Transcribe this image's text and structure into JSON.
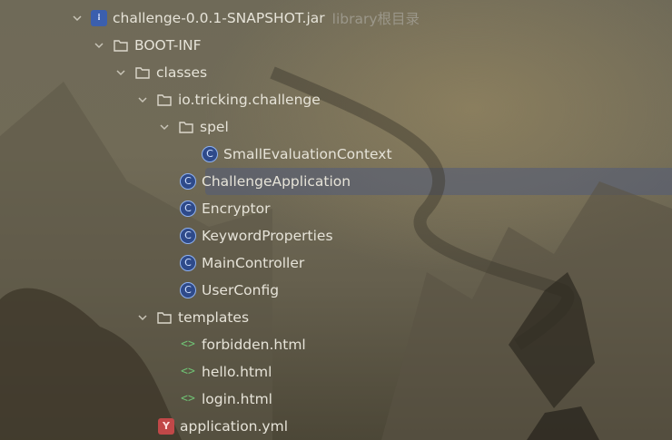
{
  "tree": {
    "jar": {
      "label": "challenge-0.0.1-SNAPSHOT.jar",
      "hint": "library根目录",
      "icon": "jar-icon"
    },
    "boot_inf": {
      "label": "BOOT-INF",
      "icon": "folder-icon"
    },
    "classes": {
      "label": "classes",
      "icon": "folder-icon"
    },
    "package": {
      "label": "io.tricking.challenge",
      "icon": "folder-icon"
    },
    "spel": {
      "label": "spel",
      "icon": "folder-icon"
    },
    "small_eval": {
      "label": "SmallEvaluationContext",
      "icon": "class-icon"
    },
    "challenge_app": {
      "label": "ChallengeApplication",
      "icon": "class-icon",
      "selected": true
    },
    "encryptor": {
      "label": "Encryptor",
      "icon": "class-icon"
    },
    "keyword_props": {
      "label": "KeywordProperties",
      "icon": "class-icon"
    },
    "main_controller": {
      "label": "MainController",
      "icon": "class-icon"
    },
    "user_config": {
      "label": "UserConfig",
      "icon": "class-icon"
    },
    "templates": {
      "label": "templates",
      "icon": "folder-icon"
    },
    "forbidden": {
      "label": "forbidden.html",
      "icon": "html-icon"
    },
    "hello": {
      "label": "hello.html",
      "icon": "html-icon"
    },
    "login": {
      "label": "login.html",
      "icon": "html-icon"
    },
    "application_yml": {
      "label": "application.yml",
      "icon": "yaml-icon"
    }
  },
  "glyphs": {
    "class": "C",
    "yml": "Y",
    "html": "<>",
    "jar": "⁞"
  },
  "colors": {
    "selection": "#565e76",
    "class_icon": "#2e4a8a",
    "yaml_icon": "#c14848",
    "html_icon": "#6fbf73",
    "hint_text": "#9b978a"
  }
}
